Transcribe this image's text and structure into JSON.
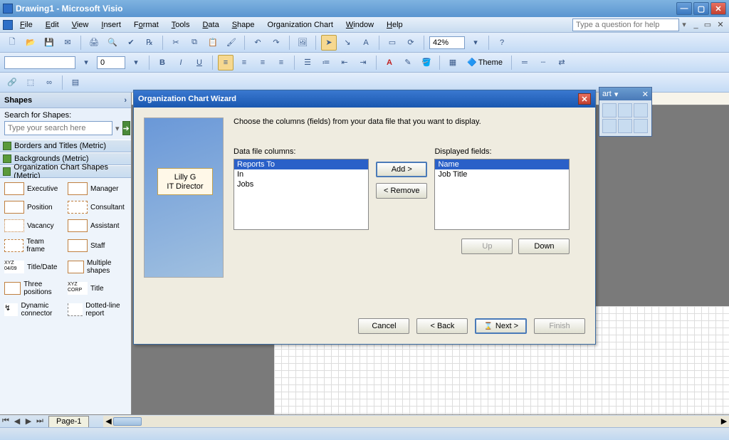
{
  "title": "Drawing1 - Microsoft Visio",
  "help_search_placeholder": "Type a question for help",
  "menu": [
    "File",
    "Edit",
    "View",
    "Insert",
    "Format",
    "Tools",
    "Data",
    "Shape",
    "Organization Chart",
    "Window",
    "Help"
  ],
  "zoom": "42%",
  "font_name": "",
  "font_size": "0",
  "theme_label": "Theme",
  "shapes": {
    "header": "Shapes",
    "search_label": "Search for Shapes:",
    "search_placeholder": "Type your search here",
    "stencils": [
      "Borders and Titles (Metric)",
      "Backgrounds (Metric)",
      "Organization Chart Shapes (Metric)"
    ],
    "items": [
      {
        "label": "Executive"
      },
      {
        "label": "Manager"
      },
      {
        "label": "Position"
      },
      {
        "label": "Consultant"
      },
      {
        "label": "Vacancy"
      },
      {
        "label": "Assistant"
      },
      {
        "label": "Team frame"
      },
      {
        "label": "Staff"
      },
      {
        "label": "Title/Date"
      },
      {
        "label": "Multiple shapes"
      },
      {
        "label": "Three positions"
      },
      {
        "label": "Title"
      },
      {
        "label": "Dynamic connector"
      },
      {
        "label": "Dotted-line report"
      }
    ]
  },
  "floatbar_title": "art",
  "page_tab": "Page-1",
  "dialog": {
    "title": "Organization Chart Wizard",
    "instruction": "Choose the columns (fields) from your data file that you want to display.",
    "left_label": "Data file columns:",
    "right_label": "Displayed fields:",
    "left_items": [
      "Reports To",
      "In",
      "Jobs"
    ],
    "right_items": [
      "Name",
      "Job Title"
    ],
    "left_selected": 0,
    "right_selected": 0,
    "preview_name": "Lilly G",
    "preview_title": "IT Director",
    "add": "Add >",
    "remove": "< Remove",
    "up": "Up",
    "down": "Down",
    "cancel": "Cancel",
    "back": "< Back",
    "next": "Next >",
    "finish": "Finish"
  }
}
